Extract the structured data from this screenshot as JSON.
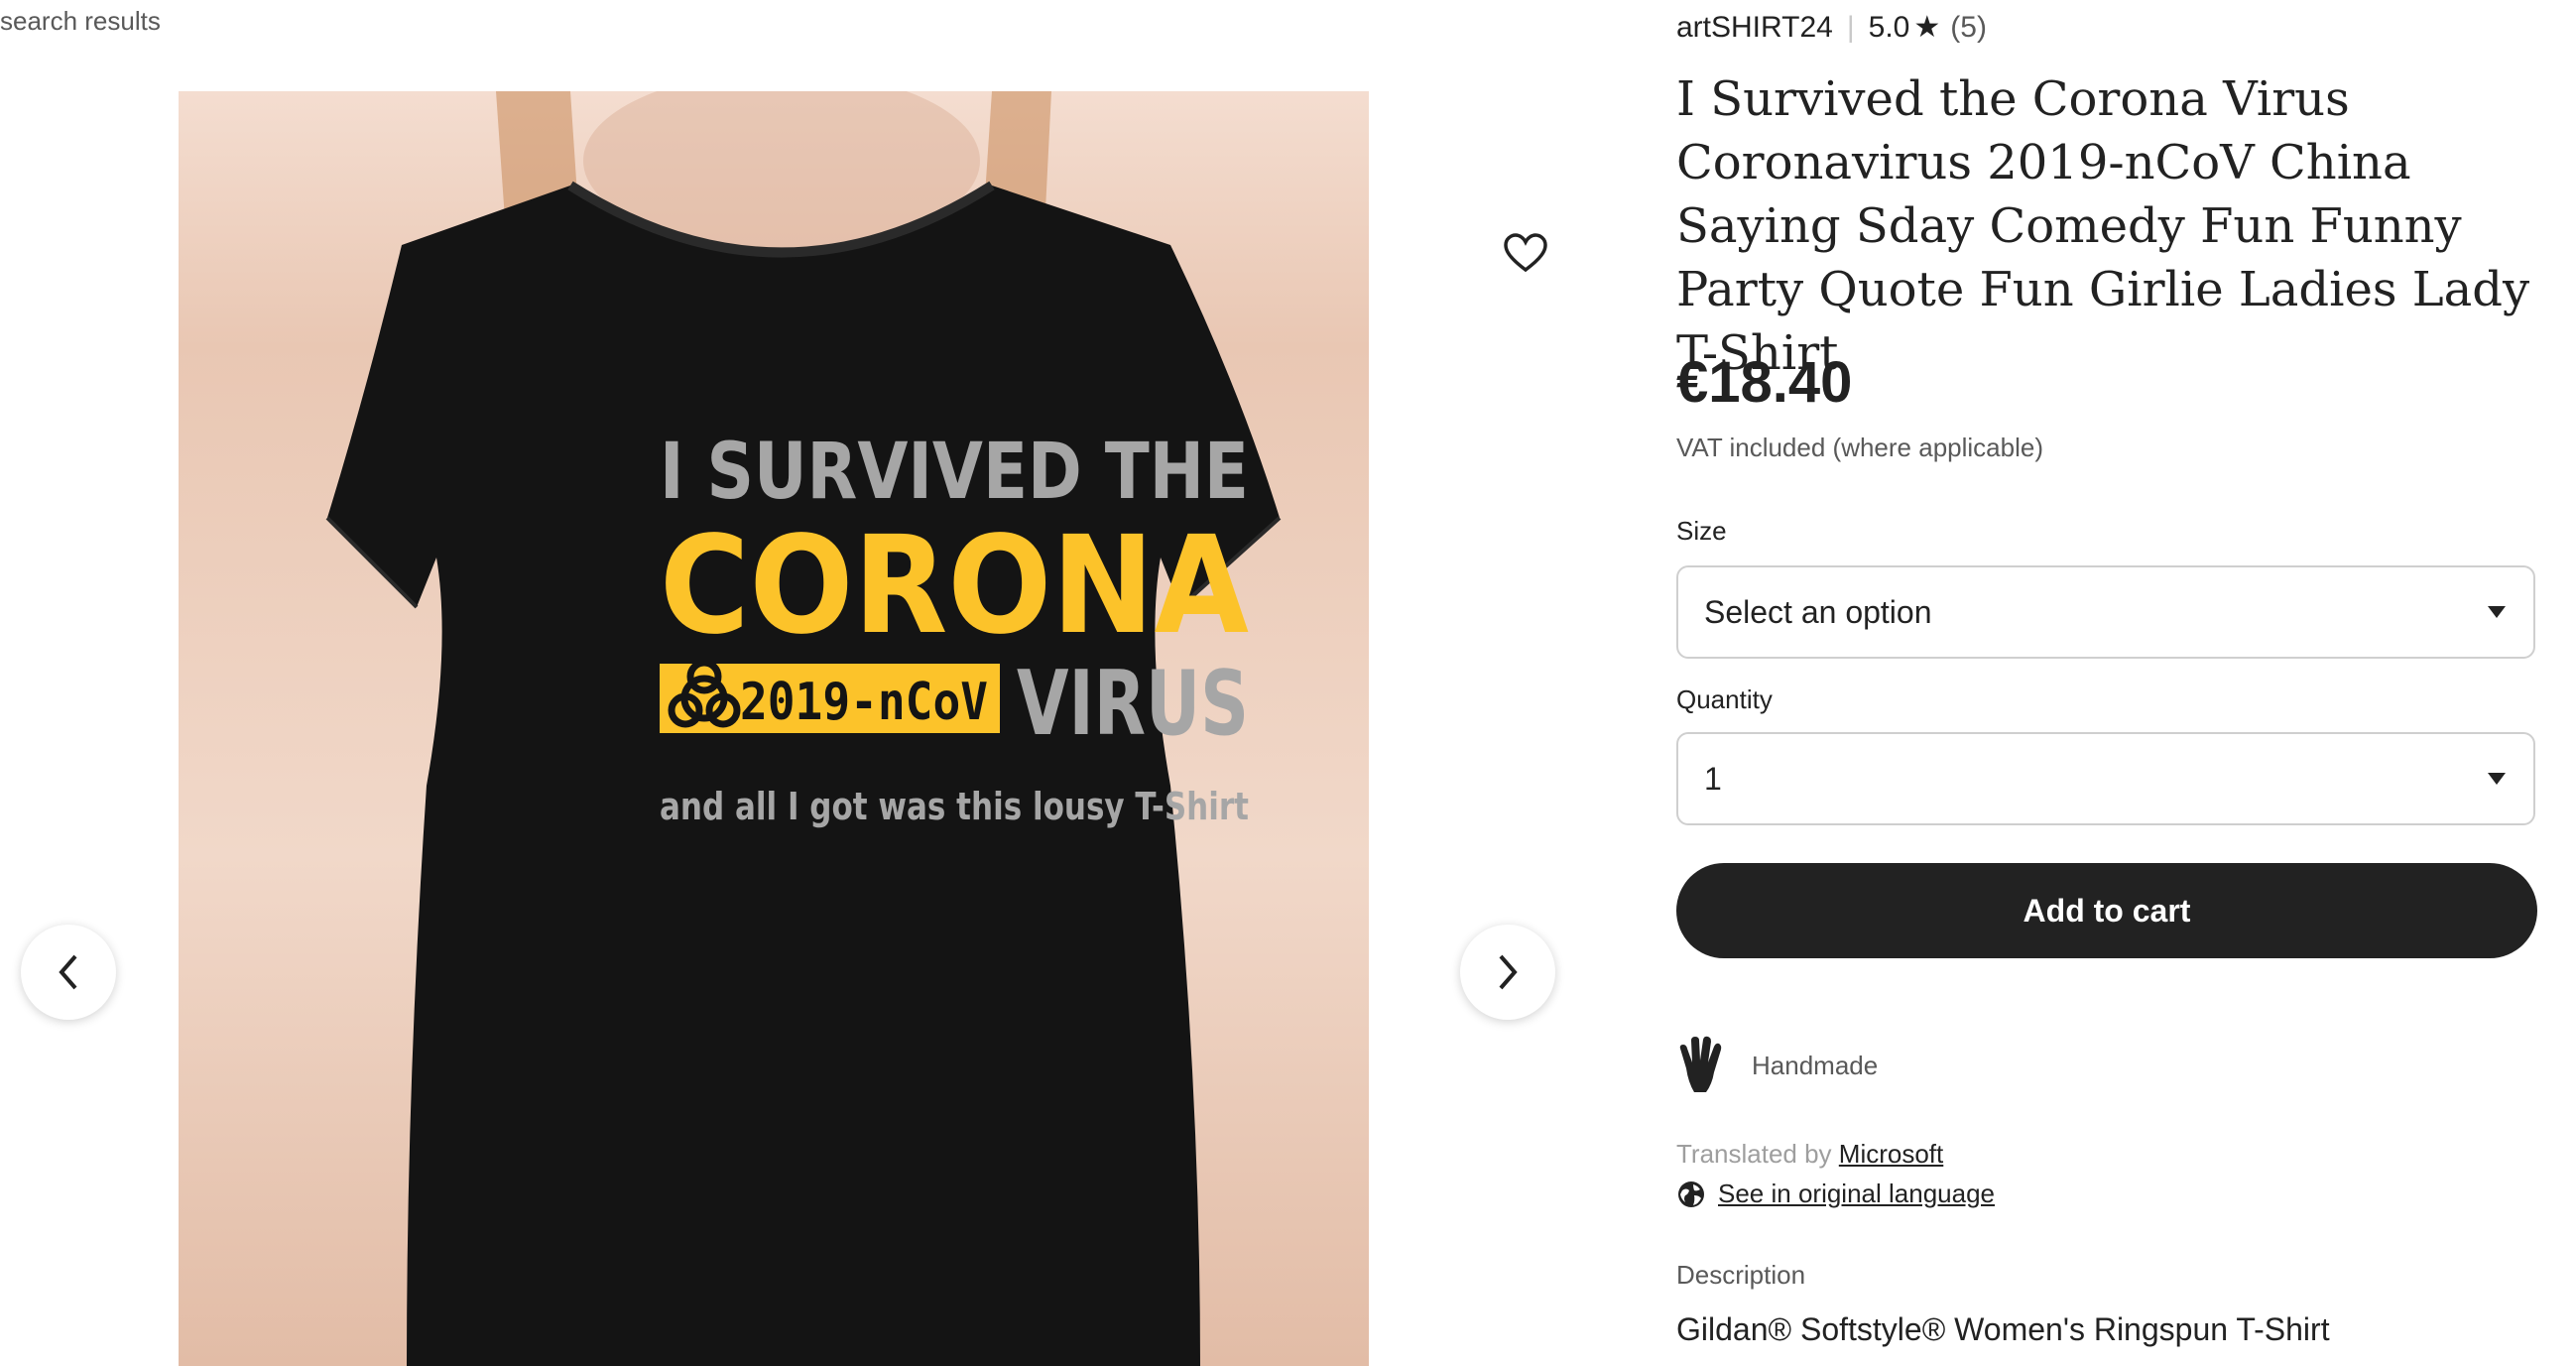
{
  "breadcrumb": {
    "back_label": "search results"
  },
  "gallery": {
    "shirt_print": {
      "line1": "I SURVIVED THE",
      "line2": "CORONA",
      "badge": "2019-nCoV",
      "line3": "VIRUS",
      "line4": "and all I got was this lousy T-Shirt"
    },
    "icons": {
      "favorite": "heart-icon",
      "prev": "chevron-left-icon",
      "next": "chevron-right-icon"
    }
  },
  "listing": {
    "shop_name": "artSHIRT24",
    "rating": "5.0",
    "rating_star": "★",
    "review_count": "(5)",
    "title": "I Survived the Corona Virus Coronavirus 2019-nCoV China Saying Sday Comedy Fun Funny Party Quote Fun Girlie Ladies Lady T-Shirt",
    "price": "€18.40",
    "vat_note": "VAT included (where applicable)",
    "size": {
      "label": "Size",
      "value": "Select an option"
    },
    "quantity": {
      "label": "Quantity",
      "value": "1"
    },
    "add_to_cart": "Add to cart",
    "handmade": "Handmade",
    "translated_prefix": "Translated by ",
    "translator": "Microsoft",
    "original_language_link": "See in original language",
    "description_label": "Description",
    "description_first_line": "Gildan® Softstyle® Women's Ringspun T-Shirt"
  },
  "colors": {
    "shirt": "#141414",
    "print_grey": "#a6a6a6",
    "print_yellow": "#fcc32a",
    "button_dark": "#222222"
  }
}
